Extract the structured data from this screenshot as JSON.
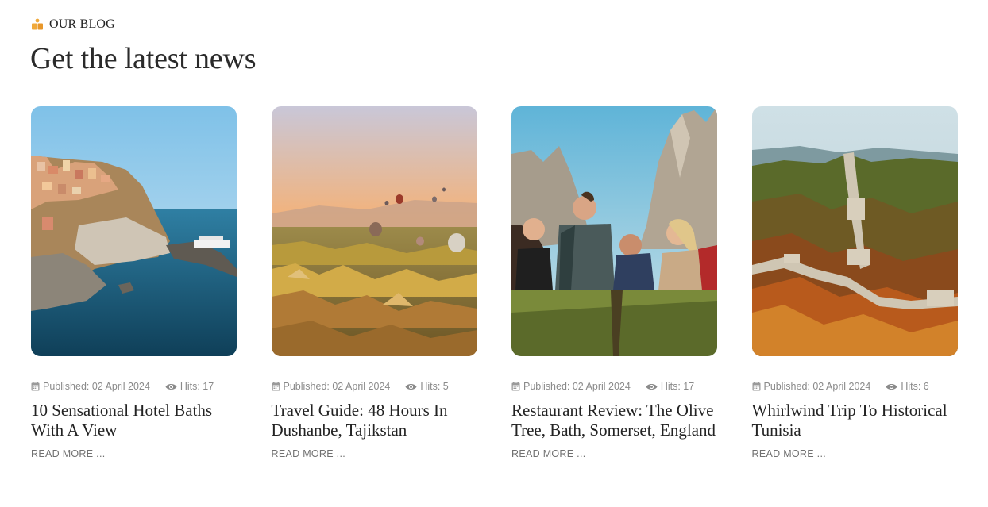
{
  "section": {
    "eyebrow": "OUR BLOG",
    "heading": "Get the latest news",
    "eyebrow_icon": "book-stack-icon",
    "accent_color": "#f0a93a"
  },
  "meta_icons": {
    "date": "calendar-icon",
    "hits": "eye-icon"
  },
  "posts": [
    {
      "image": "cliffside-village-by-sea-image",
      "published": "Published: 02 April 2024",
      "hits": "Hits: 17",
      "title": "10 Sensational Hotel Baths With A View",
      "read_more": "READ MORE ..."
    },
    {
      "image": "hot-air-balloons-valley-image",
      "published": "Published: 02 April 2024",
      "hits": "Hits: 5",
      "title": "Travel Guide: 48 Hours In Dushanbe, Tajikstan",
      "read_more": "READ MORE ..."
    },
    {
      "image": "friends-hiking-mountains-image",
      "published": "Published: 02 April 2024",
      "hits": "Hits: 17",
      "title": "Restaurant Review: The Olive Tree, Bath, Somerset, England",
      "read_more": "READ MORE ..."
    },
    {
      "image": "great-wall-autumn-image",
      "published": "Published: 02 April 2024",
      "hits": "Hits: 6",
      "title": "Whirlwind Trip To Historical Tunisia",
      "read_more": "READ MORE ..."
    }
  ]
}
